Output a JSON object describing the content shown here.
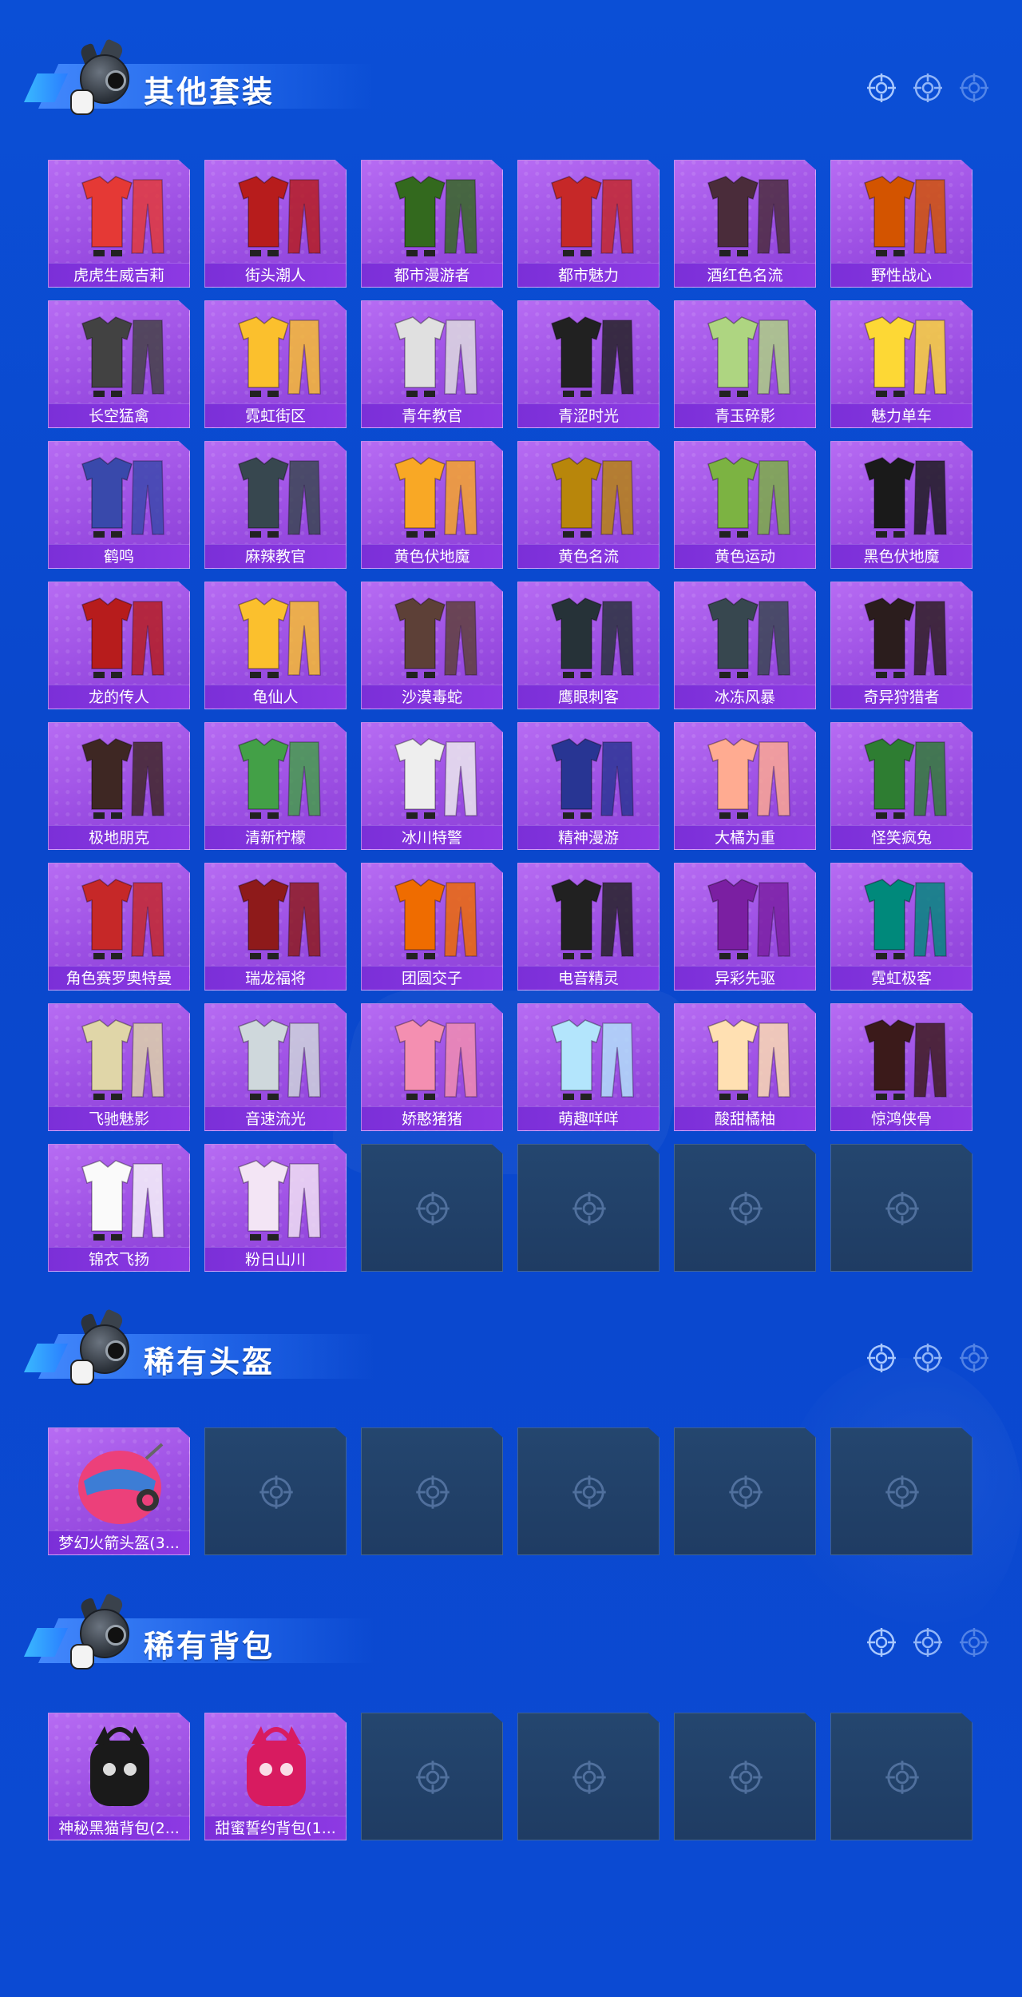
{
  "colors": {
    "background": "#0b4fd6",
    "tile_purple": "#9c4fe3",
    "label_bar": "#7b2fd8",
    "empty_slot": "#24466f"
  },
  "sections": [
    {
      "title": "其他套装",
      "items": [
        {
          "label": "虎虎生威吉莉",
          "icon": "outfit-icon",
          "hue": "#e53935"
        },
        {
          "label": "街头潮人",
          "icon": "outfit-icon",
          "hue": "#b71c1c"
        },
        {
          "label": "都市漫游者",
          "icon": "outfit-icon",
          "hue": "#33691e"
        },
        {
          "label": "都市魅力",
          "icon": "outfit-icon",
          "hue": "#c62828"
        },
        {
          "label": "酒红色名流",
          "icon": "outfit-icon",
          "hue": "#4a2c3a"
        },
        {
          "label": "野性战心",
          "icon": "outfit-icon",
          "hue": "#d35400"
        },
        {
          "label": "长空猛禽",
          "icon": "outfit-icon",
          "hue": "#424242"
        },
        {
          "label": "霓虹街区",
          "icon": "outfit-icon",
          "hue": "#fbc02d"
        },
        {
          "label": "青年教官",
          "icon": "outfit-icon",
          "hue": "#e0e0e0"
        },
        {
          "label": "青涩时光",
          "icon": "outfit-icon",
          "hue": "#212121"
        },
        {
          "label": "青玉碎影",
          "icon": "outfit-icon",
          "hue": "#aed581"
        },
        {
          "label": "魅力单车",
          "icon": "outfit-icon",
          "hue": "#fdd835"
        },
        {
          "label": "鹤鸣",
          "icon": "outfit-icon",
          "hue": "#3949ab"
        },
        {
          "label": "麻辣教官",
          "icon": "outfit-icon",
          "hue": "#37474f"
        },
        {
          "label": "黄色伏地魔",
          "icon": "outfit-icon",
          "hue": "#f9a825"
        },
        {
          "label": "黄色名流",
          "icon": "outfit-icon",
          "hue": "#b8860b"
        },
        {
          "label": "黄色运动",
          "icon": "outfit-icon",
          "hue": "#7cb342"
        },
        {
          "label": "黑色伏地魔",
          "icon": "outfit-icon",
          "hue": "#1a1a1a"
        },
        {
          "label": "龙的传人",
          "icon": "outfit-icon",
          "hue": "#b71c1c"
        },
        {
          "label": "龟仙人",
          "icon": "outfit-icon",
          "hue": "#fbc02d"
        },
        {
          "label": "沙漠毒蛇",
          "icon": "outfit-icon",
          "hue": "#5d4037"
        },
        {
          "label": "鹰眼刺客",
          "icon": "outfit-icon",
          "hue": "#263238"
        },
        {
          "label": "冰冻风暴",
          "icon": "outfit-icon",
          "hue": "#37474f"
        },
        {
          "label": "奇异狩猎者",
          "icon": "outfit-icon",
          "hue": "#2b1d1d"
        },
        {
          "label": "极地朋克",
          "icon": "outfit-icon",
          "hue": "#3e2723"
        },
        {
          "label": "清新柠檬",
          "icon": "outfit-icon",
          "hue": "#43a047"
        },
        {
          "label": "冰川特警",
          "icon": "outfit-icon",
          "hue": "#eeeeee"
        },
        {
          "label": "精神漫游",
          "icon": "outfit-icon",
          "hue": "#283593"
        },
        {
          "label": "大橘为重",
          "icon": "outfit-icon",
          "hue": "#ffab91"
        },
        {
          "label": "怪笑疯兔",
          "icon": "outfit-icon",
          "hue": "#2e7d32"
        },
        {
          "label": "角色赛罗奥特曼",
          "icon": "outfit-icon",
          "hue": "#c62828"
        },
        {
          "label": "瑞龙福将",
          "icon": "outfit-icon",
          "hue": "#8e1a1a"
        },
        {
          "label": "团圆交子",
          "icon": "outfit-icon",
          "hue": "#ef6c00"
        },
        {
          "label": "电音精灵",
          "icon": "outfit-icon",
          "hue": "#212121"
        },
        {
          "label": "异彩先驱",
          "icon": "outfit-icon",
          "hue": "#7b1fa2"
        },
        {
          "label": "霓虹极客",
          "icon": "outfit-icon",
          "hue": "#00897b"
        },
        {
          "label": "飞驰魅影",
          "icon": "outfit-icon",
          "hue": "#e0d6a8"
        },
        {
          "label": "音速流光",
          "icon": "outfit-icon",
          "hue": "#cfd8dc"
        },
        {
          "label": "娇憨猪猪",
          "icon": "outfit-icon",
          "hue": "#f48fb1"
        },
        {
          "label": "萌趣咩咩",
          "icon": "outfit-icon",
          "hue": "#b3e5fc"
        },
        {
          "label": "酸甜橘柚",
          "icon": "outfit-icon",
          "hue": "#ffe0b2"
        },
        {
          "label": "惊鸿侠骨",
          "icon": "outfit-icon",
          "hue": "#3b1a1a"
        },
        {
          "label": "锦衣飞扬",
          "icon": "outfit-icon",
          "hue": "#fafafa"
        },
        {
          "label": "粉日山川",
          "icon": "outfit-icon",
          "hue": "#f3e5f5"
        }
      ],
      "empty_slots": 4
    },
    {
      "title": "稀有头盔",
      "items": [
        {
          "label": "梦幻火箭头盔(3...",
          "icon": "helmet-icon",
          "hue": "#ec407a"
        }
      ],
      "empty_slots": 5
    },
    {
      "title": "稀有背包",
      "items": [
        {
          "label": "神秘黑猫背包(2...",
          "icon": "backpack-icon",
          "hue": "#1a1a1a"
        },
        {
          "label": "甜蜜誓约背包(1...",
          "icon": "backpack-icon",
          "hue": "#d81b60"
        }
      ],
      "empty_slots": 4
    }
  ]
}
